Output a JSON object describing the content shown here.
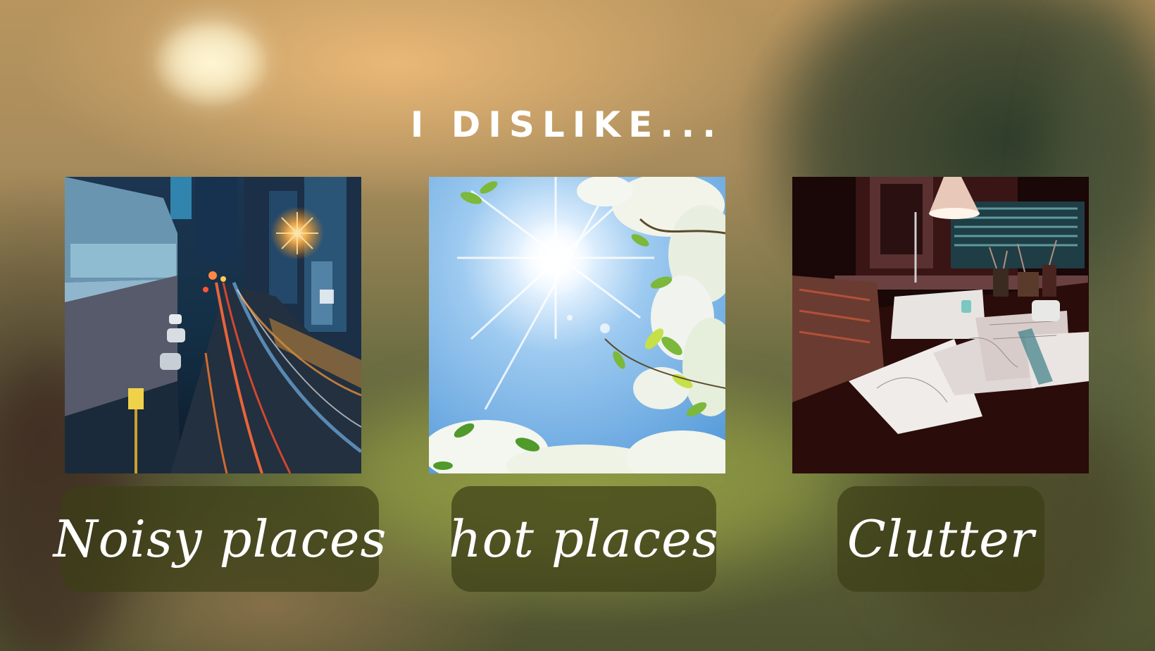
{
  "slide": {
    "title": "I DISLIKE...",
    "items": [
      {
        "caption": "Noisy places",
        "image": "city-street-night-traffic-photo"
      },
      {
        "caption": "hot places",
        "image": "sun-through-blossoms-photo"
      },
      {
        "caption": "Clutter",
        "image": "cluttered-desk-photo"
      }
    ]
  },
  "colors": {
    "title_text": "#ffffff",
    "caption_box": "#3c3e16",
    "caption_text": "#ffffff"
  }
}
